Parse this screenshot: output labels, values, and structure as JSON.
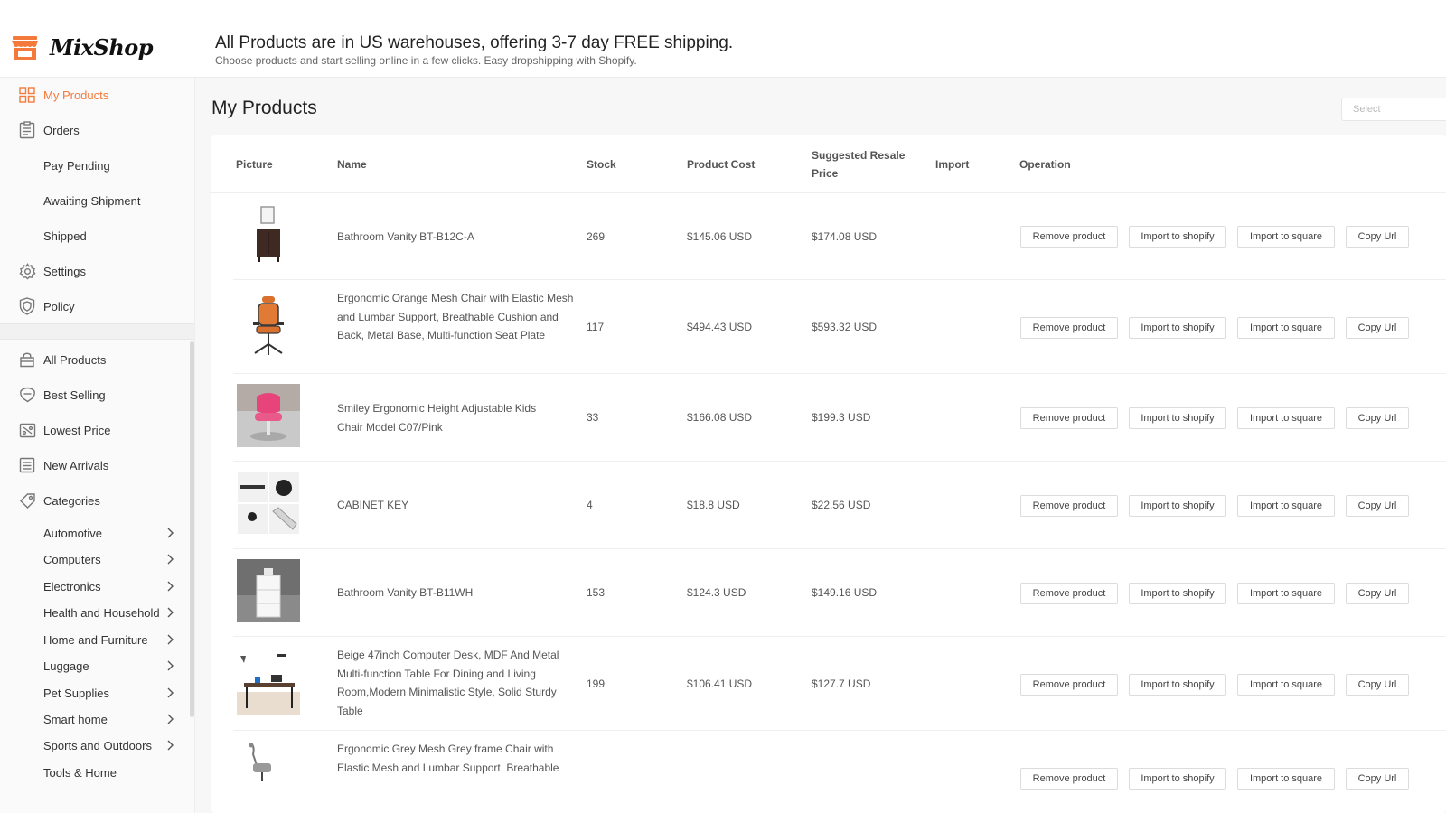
{
  "brand": {
    "name": "MixShop",
    "accent": "#f47a3b"
  },
  "banner": {
    "title": "All Products are in US warehouses, offering 3-7 day FREE shipping.",
    "subtitle": "Choose products and start selling online in a few clicks. Easy dropshipping with Shopify."
  },
  "sidebar": {
    "top_items": [
      {
        "label": "My Products",
        "icon": "grid-icon",
        "active": true
      },
      {
        "label": "Orders",
        "icon": "clipboard-icon"
      },
      {
        "label": "Pay Pending"
      },
      {
        "label": "Awaiting Shipment"
      },
      {
        "label": "Shipped"
      },
      {
        "label": "Settings",
        "icon": "gear-icon"
      },
      {
        "label": "Policy",
        "icon": "shield-icon"
      }
    ],
    "catalog_items": [
      {
        "label": "All Products",
        "icon": "bag-icon"
      },
      {
        "label": "Best Selling",
        "icon": "badge-icon"
      },
      {
        "label": "Lowest Price",
        "icon": "price-tag-icon"
      },
      {
        "label": "New Arrivals",
        "icon": "list-icon"
      },
      {
        "label": "Categories",
        "icon": "tag-icon"
      }
    ],
    "categories": [
      "Automotive",
      "Computers",
      "Electronics",
      "Health and Household",
      "Home and Furniture",
      "Luggage",
      "Pet Supplies",
      "Smart home",
      "Sports and Outdoors",
      "Tools & Home"
    ]
  },
  "main": {
    "title": "My Products",
    "select_placeholder": "Select",
    "columns": {
      "picture": "Picture",
      "name": "Name",
      "stock": "Stock",
      "cost": "Product Cost",
      "resale_line1": "Suggested Resale",
      "resale_line2": "Price",
      "import": "Import",
      "operation": "Operation"
    },
    "buttons": {
      "remove": "Remove product",
      "shopify": "Import to shopify",
      "square": "Import to square",
      "copy": "Copy Url"
    },
    "rows": [
      {
        "name": "Bathroom Vanity BT-B12C-A",
        "stock": "269",
        "cost": "$145.06 USD",
        "resale": "$174.08 USD"
      },
      {
        "name": "Ergonomic Orange Mesh Chair with Elastic Mesh and Lumbar Support, Breathable Cushion and Back, Metal Base, Multi-function Seat Plate",
        "stock": "117",
        "cost": "$494.43 USD",
        "resale": "$593.32 USD"
      },
      {
        "name": "Smiley Ergonomic Height Adjustable Kids Chair Model C07/Pink",
        "stock": "33",
        "cost": "$166.08 USD",
        "resale": "$199.3 USD"
      },
      {
        "name": "CABINET KEY",
        "stock": "4",
        "cost": "$18.8 USD",
        "resale": "$22.56 USD"
      },
      {
        "name": "Bathroom Vanity BT-B11WH",
        "stock": "153",
        "cost": "$124.3 USD",
        "resale": "$149.16 USD"
      },
      {
        "name": "Beige 47inch Computer Desk, MDF And Metal Multi-function Table For Dining and Living Room,Modern Minimalistic Style, Solid Sturdy Table",
        "stock": "199",
        "cost": "$106.41 USD",
        "resale": "$127.7 USD"
      },
      {
        "name": "Ergonomic Grey Mesh Grey frame Chair with Elastic Mesh and Lumbar Support, Breathable",
        "stock": "",
        "cost": "",
        "resale": ""
      }
    ]
  }
}
